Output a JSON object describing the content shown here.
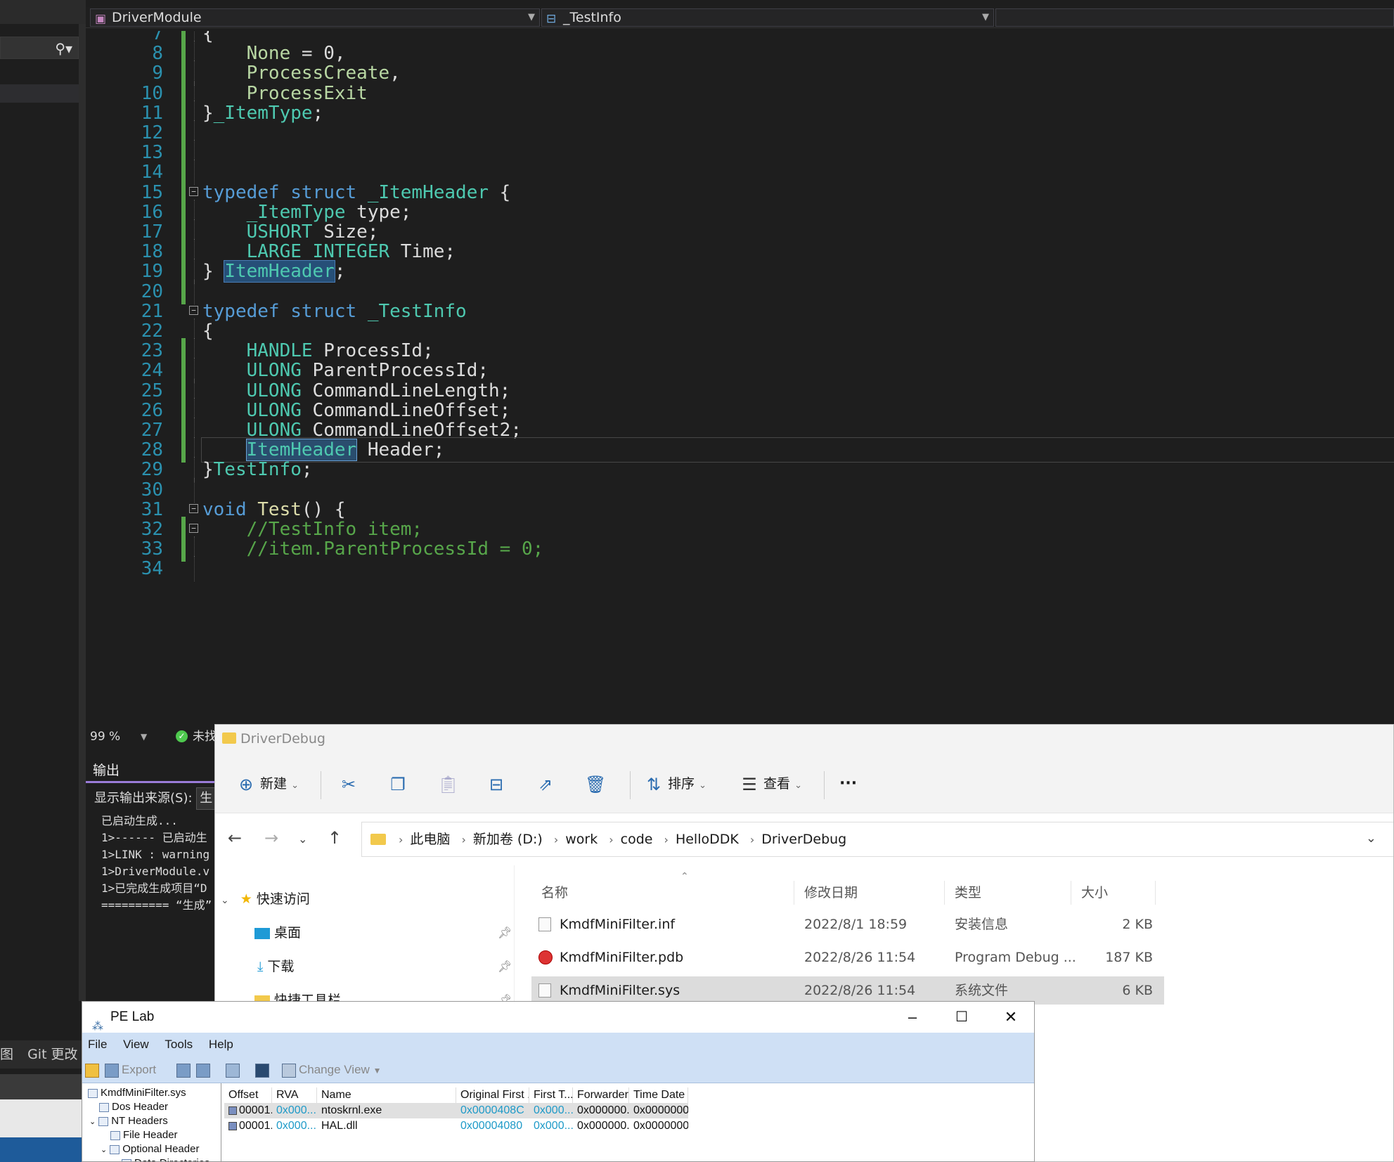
{
  "editor": {
    "nav_project": "DriverModule",
    "nav_symbol": "_TestInfo",
    "zoom": "99 %",
    "status_text": "未找",
    "lines": [
      {
        "n": "7",
        "gutter": true,
        "fold": false,
        "tokens": [
          [
            "pl",
            "{"
          ]
        ]
      },
      {
        "n": "8",
        "gutter": true,
        "fold": false,
        "tokens": [
          [
            "pl",
            "    "
          ],
          [
            "en",
            "None"
          ],
          [
            "pl",
            " = 0,"
          ]
        ]
      },
      {
        "n": "9",
        "gutter": true,
        "fold": false,
        "tokens": [
          [
            "pl",
            "    "
          ],
          [
            "en",
            "ProcessCreate"
          ],
          [
            "pl",
            ","
          ]
        ]
      },
      {
        "n": "10",
        "gutter": true,
        "fold": false,
        "tokens": [
          [
            "pl",
            "    "
          ],
          [
            "en",
            "ProcessExit"
          ]
        ]
      },
      {
        "n": "11",
        "gutter": true,
        "fold": false,
        "tokens": [
          [
            "pl",
            "}"
          ],
          [
            "ty",
            "_ItemType"
          ],
          [
            "pl",
            ";"
          ]
        ]
      },
      {
        "n": "12",
        "gutter": true,
        "fold": false,
        "tokens": []
      },
      {
        "n": "13",
        "gutter": true,
        "fold": false,
        "tokens": []
      },
      {
        "n": "14",
        "gutter": true,
        "fold": false,
        "tokens": []
      },
      {
        "n": "15",
        "gutter": true,
        "fold": true,
        "tokens": [
          [
            "kw",
            "typedef"
          ],
          [
            "pl",
            " "
          ],
          [
            "kw",
            "struct"
          ],
          [
            "pl",
            " "
          ],
          [
            "ty",
            "_ItemHeader"
          ],
          [
            "pl",
            " {"
          ]
        ]
      },
      {
        "n": "16",
        "gutter": true,
        "fold": false,
        "tokens": [
          [
            "pl",
            "    "
          ],
          [
            "ty",
            "_ItemType"
          ],
          [
            "pl",
            " type;"
          ]
        ]
      },
      {
        "n": "17",
        "gutter": true,
        "fold": false,
        "tokens": [
          [
            "pl",
            "    "
          ],
          [
            "ty",
            "USHORT"
          ],
          [
            "pl",
            " Size;"
          ]
        ]
      },
      {
        "n": "18",
        "gutter": true,
        "fold": false,
        "tokens": [
          [
            "pl",
            "    "
          ],
          [
            "ty",
            "LARGE_INTEGER"
          ],
          [
            "pl",
            " Time;"
          ]
        ]
      },
      {
        "n": "19",
        "gutter": true,
        "fold": false,
        "tokens": [
          [
            "pl",
            "} "
          ],
          [
            "hl",
            "ItemHeader"
          ],
          [
            "pl",
            ";"
          ]
        ]
      },
      {
        "n": "20",
        "gutter": true,
        "fold": false,
        "tokens": []
      },
      {
        "n": "21",
        "gutter": false,
        "fold": true,
        "tokens": [
          [
            "kw",
            "typedef"
          ],
          [
            "pl",
            " "
          ],
          [
            "kw",
            "struct"
          ],
          [
            "pl",
            " "
          ],
          [
            "ty",
            "_TestInfo"
          ]
        ]
      },
      {
        "n": "22",
        "gutter": false,
        "fold": false,
        "tokens": [
          [
            "pl",
            "{"
          ]
        ]
      },
      {
        "n": "23",
        "gutter": true,
        "fold": false,
        "tokens": [
          [
            "pl",
            "    "
          ],
          [
            "ty",
            "HANDLE"
          ],
          [
            "pl",
            " ProcessId;"
          ]
        ]
      },
      {
        "n": "24",
        "gutter": true,
        "fold": false,
        "tokens": [
          [
            "pl",
            "    "
          ],
          [
            "ty",
            "ULONG"
          ],
          [
            "pl",
            " ParentProcessId;"
          ]
        ]
      },
      {
        "n": "25",
        "gutter": true,
        "fold": false,
        "tokens": [
          [
            "pl",
            "    "
          ],
          [
            "ty",
            "ULONG"
          ],
          [
            "pl",
            " CommandLineLength;"
          ]
        ]
      },
      {
        "n": "26",
        "gutter": true,
        "fold": false,
        "tokens": [
          [
            "pl",
            "    "
          ],
          [
            "ty",
            "ULONG"
          ],
          [
            "pl",
            " CommandLineOffset;"
          ]
        ]
      },
      {
        "n": "27",
        "gutter": true,
        "fold": false,
        "tokens": [
          [
            "pl",
            "    "
          ],
          [
            "ty",
            "ULONG"
          ],
          [
            "pl",
            " CommandLineOffset2;"
          ]
        ]
      },
      {
        "n": "28",
        "gutter": true,
        "fold": false,
        "current": true,
        "tokens": [
          [
            "pl",
            "    "
          ],
          [
            "hl2",
            "ItemHeader"
          ],
          [
            "pl",
            " Header;"
          ]
        ]
      },
      {
        "n": "29",
        "gutter": false,
        "fold": false,
        "tokens": [
          [
            "pl",
            "}"
          ],
          [
            "ty",
            "TestInfo"
          ],
          [
            "pl",
            ";"
          ]
        ]
      },
      {
        "n": "30",
        "gutter": false,
        "fold": false,
        "tokens": []
      },
      {
        "n": "31",
        "gutter": false,
        "fold": true,
        "tokens": [
          [
            "kw",
            "void"
          ],
          [
            "pl",
            " "
          ],
          [
            "fn",
            "Test"
          ],
          [
            "pl",
            "() {"
          ]
        ]
      },
      {
        "n": "32",
        "gutter": true,
        "fold": true,
        "tokens": [
          [
            "pl",
            "    "
          ],
          [
            "cm",
            "//TestInfo item;"
          ]
        ]
      },
      {
        "n": "33",
        "gutter": true,
        "fold": false,
        "tokens": [
          [
            "pl",
            "    "
          ],
          [
            "cm",
            "//item.ParentProcessId = 0;"
          ]
        ]
      },
      {
        "n": "34",
        "gutter": false,
        "fold": false,
        "tokens": []
      }
    ]
  },
  "vs_left": {
    "bottom_tabs": [
      "图",
      "Git 更改"
    ]
  },
  "output": {
    "tab_label": "输出",
    "source_label": "显示输出来源(S):",
    "source_value": "生",
    "lines": [
      "已启动生成...",
      "1>------ 已启动生",
      "1>LINK : warning",
      "1>DriverModule.v",
      "1>已完成生成项目“D",
      "========== “生成”"
    ]
  },
  "explorer": {
    "title": "DriverDebug",
    "commands": {
      "new": "新建",
      "sort": "排序",
      "view": "查看",
      "more": "···"
    },
    "breadcrumb": [
      "此电脑",
      "新加卷 (D:)",
      "work",
      "code",
      "HelloDDK",
      "DriverDebug"
    ],
    "nav": {
      "quick_access": "快速访问",
      "items": [
        "桌面",
        "下载",
        "快捷工具栏"
      ]
    },
    "columns": {
      "name": "名称",
      "modified": "修改日期",
      "type": "类型",
      "size": "大小"
    },
    "files": [
      {
        "name": "KmdfMiniFilter.inf",
        "modified": "2022/8/1 18:59",
        "type": "安装信息",
        "size": "2 KB",
        "icon": "inf-file-icon",
        "selected": false
      },
      {
        "name": "KmdfMiniFilter.pdb",
        "modified": "2022/8/26 11:54",
        "type": "Program Debug ...",
        "size": "187 KB",
        "icon": "pdb-file-icon",
        "selected": false
      },
      {
        "name": "KmdfMiniFilter.sys",
        "modified": "2022/8/26 11:54",
        "type": "系统文件",
        "size": "6 KB",
        "icon": "sys-file-icon",
        "selected": true
      }
    ]
  },
  "pelab": {
    "title": "PE Lab",
    "menu": [
      "File",
      "View",
      "Tools",
      "Help"
    ],
    "toolbar": {
      "export": "Export",
      "change_view": "Change View"
    },
    "tree": [
      {
        "label": "KmdfMiniFilter.sys",
        "depth": 0
      },
      {
        "label": "Dos Header",
        "depth": 1
      },
      {
        "label": "NT Headers",
        "depth": 1,
        "expanded": true
      },
      {
        "label": "File Header",
        "depth": 2
      },
      {
        "label": "Optional Header",
        "depth": 2,
        "expanded": true
      },
      {
        "label": "Data Directories",
        "depth": 3
      }
    ],
    "columns": [
      "Offset",
      "RVA",
      "Name",
      "Original First ...",
      "First T...",
      "Forwarder...",
      "Time Date ..."
    ],
    "rows": [
      {
        "offset": "00001...",
        "rva": "0x000...",
        "name": "ntoskrnl.exe",
        "oft": "0x0000408C",
        "ft": "0x000...",
        "fwd": "0x000000...",
        "tds": "0x00000000",
        "selected": true
      },
      {
        "offset": "00001...",
        "rva": "0x000...",
        "name": "HAL.dll",
        "oft": "0x00004080",
        "ft": "0x000...",
        "fwd": "0x000000...",
        "tds": "0x00000000",
        "selected": false
      }
    ]
  }
}
